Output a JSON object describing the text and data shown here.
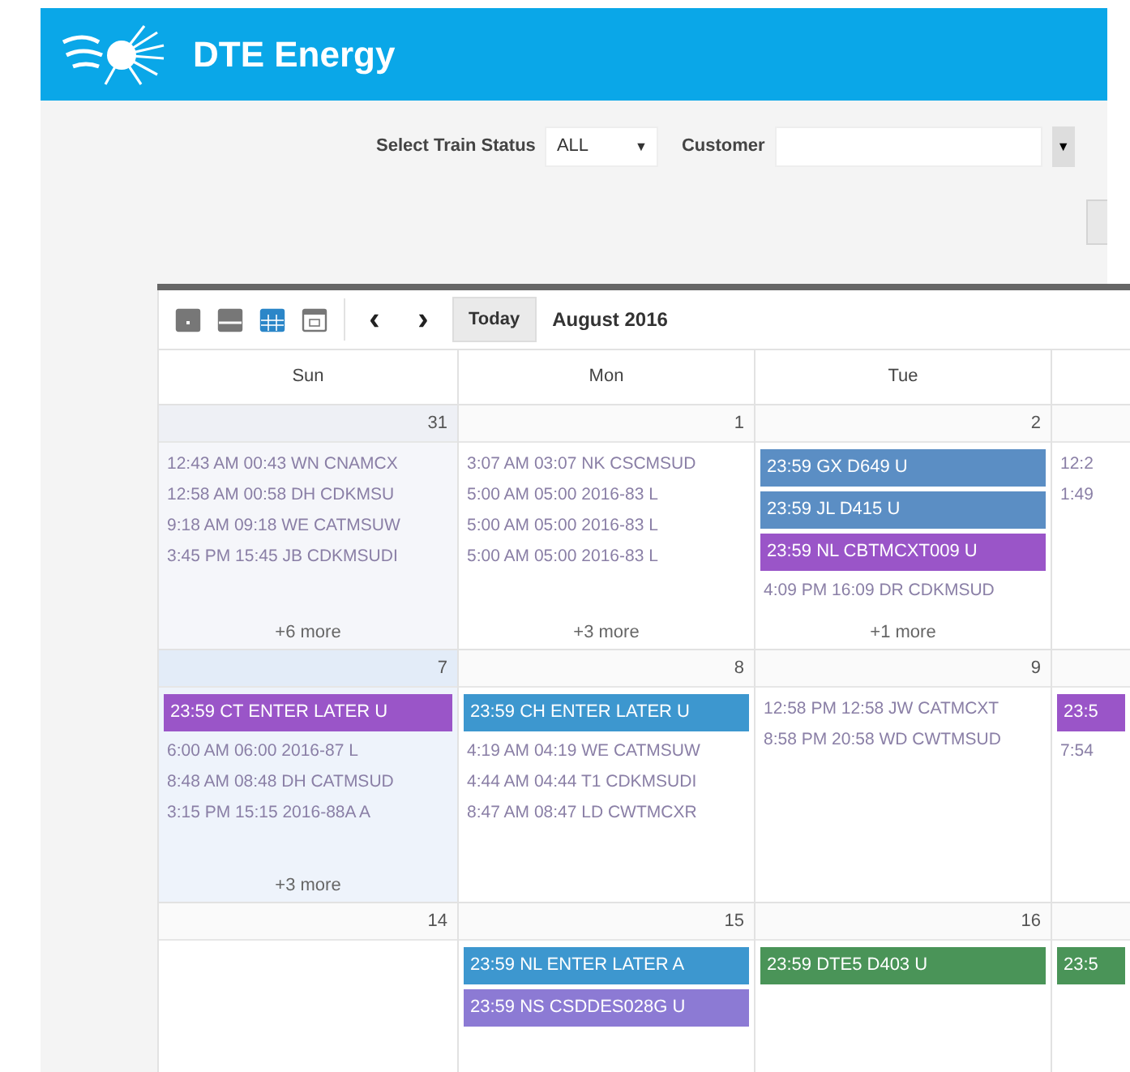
{
  "header": {
    "brand": "DTE Energy"
  },
  "filters": {
    "status_label": "Select Train Status",
    "status_value": "ALL",
    "status_caret": "▼",
    "customer_label": "Customer",
    "customer_caret": "▼"
  },
  "toolbar": {
    "views": [
      {
        "kind": "day",
        "selected": false
      },
      {
        "kind": "week",
        "selected": false
      },
      {
        "kind": "month",
        "selected": true
      },
      {
        "kind": "agenda",
        "selected": false
      }
    ],
    "prev": "‹",
    "next": "›",
    "today": "Today",
    "title": "August 2016"
  },
  "columns": [
    "Sun",
    "Mon",
    "Tue"
  ],
  "weeks": [
    {
      "days": [
        {
          "number": "31",
          "other_month": true,
          "highlighted": false,
          "more": "+6 more",
          "events": [
            {
              "kind": "text",
              "text": "12:43 AM 00:43 WN CNAMCX"
            },
            {
              "kind": "text",
              "text": "12:58 AM 00:58 DH CDKMSU"
            },
            {
              "kind": "text",
              "text": "9:18 AM 09:18 WE CATMSUW"
            },
            {
              "kind": "text",
              "text": "3:45 PM 15:45 JB CDKMSUDI"
            }
          ]
        },
        {
          "number": "1",
          "other_month": false,
          "highlighted": false,
          "more": "+3 more",
          "events": [
            {
              "kind": "text",
              "text": "3:07 AM 03:07 NK CSCMSUD"
            },
            {
              "kind": "text",
              "text": "5:00 AM 05:00 2016-83 L"
            },
            {
              "kind": "text",
              "text": "5:00 AM 05:00 2016-83 L"
            },
            {
              "kind": "text",
              "text": "5:00 AM 05:00 2016-83 L"
            }
          ]
        },
        {
          "number": "2",
          "other_month": false,
          "highlighted": false,
          "more": "+1 more",
          "events": [
            {
              "kind": "bar",
              "text": "23:59 GX D649 U",
              "color": "#5b8ec4"
            },
            {
              "kind": "bar",
              "text": "23:59 JL D415 U",
              "color": "#5b8ec4"
            },
            {
              "kind": "bar",
              "text": "23:59 NL CBTMCXT009 U",
              "color": "#9a55c8"
            },
            {
              "kind": "text",
              "text": "4:09 PM 16:09 DR CDKMSUD"
            }
          ]
        },
        {
          "other_month": false,
          "highlighted": false,
          "events": [
            {
              "kind": "text",
              "text": "12:2"
            },
            {
              "kind": "text",
              "text": "1:49"
            }
          ]
        }
      ]
    },
    {
      "days": [
        {
          "number": "7",
          "other_month": false,
          "highlighted": true,
          "more": "+3 more",
          "events": [
            {
              "kind": "bar",
              "text": "23:59 CT ENTER LATER U",
              "color": "#9a55c8"
            },
            {
              "kind": "text",
              "text": "6:00 AM 06:00 2016-87 L"
            },
            {
              "kind": "text",
              "text": "8:48 AM 08:48 DH CATMSUD"
            },
            {
              "kind": "text",
              "text": "3:15 PM 15:15 2016-88A A"
            }
          ]
        },
        {
          "number": "8",
          "other_month": false,
          "highlighted": false,
          "events": [
            {
              "kind": "bar",
              "text": "23:59 CH ENTER LATER U",
              "color": "#3d97cf"
            },
            {
              "kind": "text",
              "text": "4:19 AM 04:19 WE CATMSUW"
            },
            {
              "kind": "text",
              "text": "4:44 AM 04:44 T1 CDKMSUDI"
            },
            {
              "kind": "text",
              "text": "8:47 AM 08:47 LD CWTMCXR"
            }
          ]
        },
        {
          "number": "9",
          "other_month": false,
          "highlighted": false,
          "events": [
            {
              "kind": "text",
              "text": "12:58 PM 12:58 JW CATMCXT"
            },
            {
              "kind": "text",
              "text": "8:58 PM 20:58 WD CWTMSUD"
            }
          ]
        },
        {
          "other_month": false,
          "highlighted": false,
          "events": [
            {
              "kind": "bar",
              "text": "23:5",
              "color": "#9a55c8"
            },
            {
              "kind": "text",
              "text": "7:54"
            }
          ]
        }
      ]
    },
    {
      "days": [
        {
          "number": "14",
          "other_month": false,
          "highlighted": false
        },
        {
          "number": "15",
          "other_month": false,
          "highlighted": false,
          "events": [
            {
              "kind": "bar",
              "text": "23:59 NL ENTER LATER A",
              "color": "#3d97cf"
            },
            {
              "kind": "bar",
              "text": "23:59 NS CSDDES028G U",
              "color": "#8c7ad4"
            }
          ]
        },
        {
          "number": "16",
          "other_month": false,
          "highlighted": false,
          "events": [
            {
              "kind": "bar",
              "text": "23:59 DTE5 D403 U",
              "color": "#4a9458"
            }
          ]
        },
        {
          "other_month": false,
          "highlighted": false,
          "events": [
            {
              "kind": "bar",
              "text": "23:5",
              "color": "#4a9458"
            }
          ]
        }
      ]
    }
  ]
}
